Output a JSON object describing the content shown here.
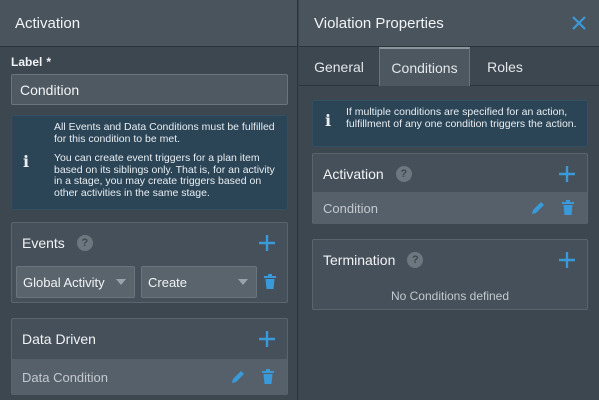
{
  "left": {
    "title": "Activation",
    "label_field": {
      "label": "Label",
      "required_mark": "*",
      "value": "Condition"
    },
    "info": {
      "line1": "All Events and Data Conditions must be fulfilled for this condition to be met.",
      "line2": "You can create event triggers for a plan item based on its siblings only. That is, for an activity in a stage, you may create triggers based on other activities in the same stage."
    },
    "events": {
      "title": "Events",
      "help": "?",
      "source_select": "Global Activity",
      "event_select": "Create"
    },
    "data_driven": {
      "title": "Data Driven",
      "item": "Data Condition"
    }
  },
  "right": {
    "title": "Violation Properties",
    "tabs": [
      "General",
      "Conditions",
      "Roles"
    ],
    "active_tab": "Conditions",
    "info": "If multiple conditions are specified for an action, fulfillment of any one condition triggers the action.",
    "activation": {
      "title": "Activation",
      "help": "?",
      "item": "Condition"
    },
    "termination": {
      "title": "Termination",
      "help": "?",
      "empty": "No Conditions defined"
    }
  },
  "colors": {
    "accent": "#3a9ad9",
    "background": "#3d4750"
  }
}
